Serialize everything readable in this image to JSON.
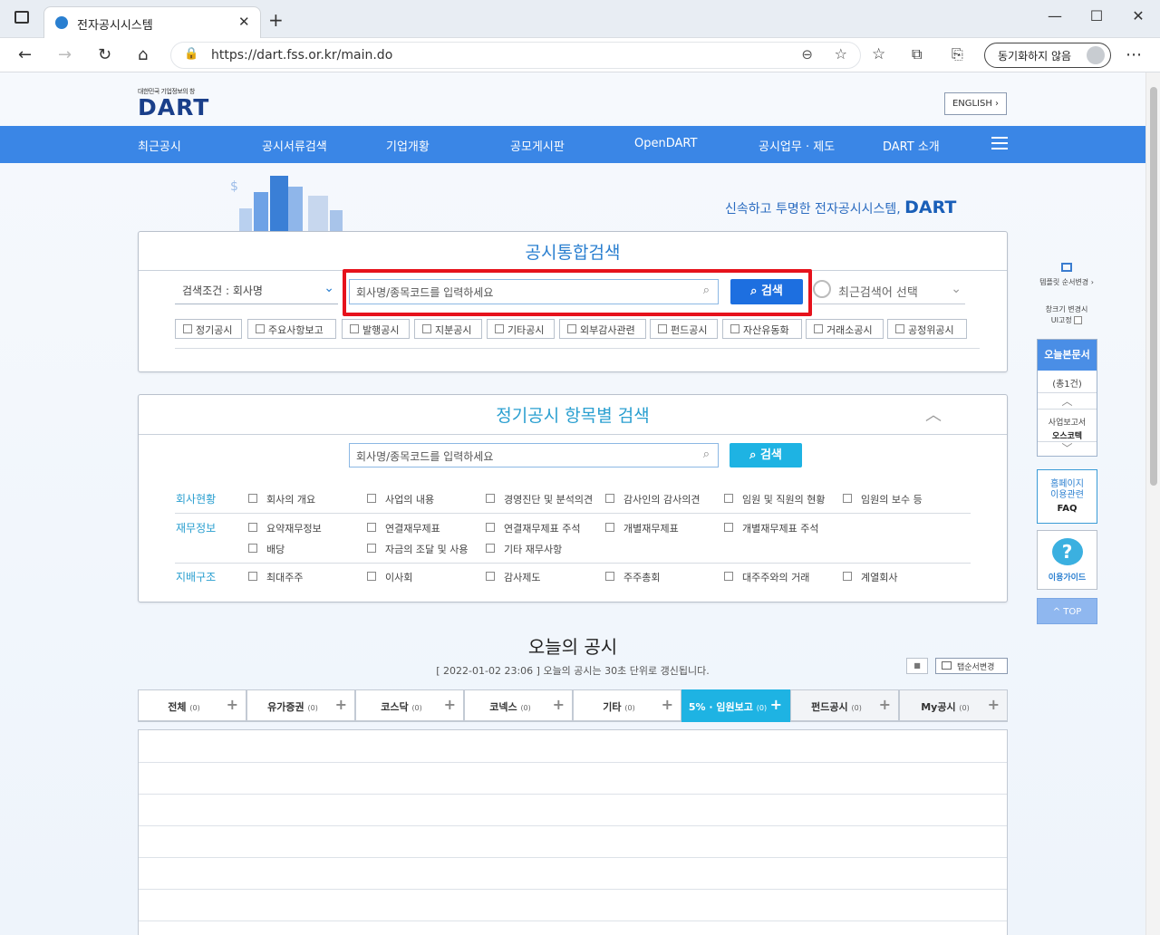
{
  "browser": {
    "tab_title": "전자공시시스템",
    "tab_close": "✕",
    "new_tab": "+",
    "url": "https://dart.fss.or.kr/main.do",
    "sync_label": "동기화하지 않음",
    "win_min": "—",
    "win_max": "☐",
    "win_close": "✕"
  },
  "header": {
    "logo_sub": "대한민국 기업정보의 창",
    "logo_main": "DART",
    "english_label": "ENGLISH ›",
    "slogan": "신속하고 투명한 전자공시시스템,",
    "slogan_brand": "DART"
  },
  "gnb": {
    "items": [
      "최근공시",
      "공시서류검색",
      "기업개황",
      "공모게시판",
      "OpenDART",
      "공시업무 · 제도",
      "DART 소개"
    ]
  },
  "integrated_search": {
    "title": "공시통합검색",
    "condition_label": "검색조건 : 회사명",
    "placeholder": "회사명/종목코드를 입력하세요",
    "search_button": "검색",
    "recent_label": "최근검색어 선택",
    "checkboxes": [
      "정기공시",
      "주요사항보고",
      "발행공시",
      "지분공시",
      "기타공시",
      "외부감사관련",
      "펀드공시",
      "자산유동화",
      "거래소공시",
      "공정위공시"
    ]
  },
  "periodic_search": {
    "title": "정기공시 항목별 검색",
    "placeholder": "회사명/종목코드를 입력하세요",
    "search_button": "검색",
    "categories": [
      {
        "name": "회사현황",
        "items": [
          "회사의 개요",
          "사업의 내용",
          "경영진단 및 분석의견",
          "감사인의 감사의견",
          "임원 및 직원의 현황",
          "임원의 보수 등"
        ]
      },
      {
        "name": "재무정보",
        "items": [
          "요약재무정보",
          "연결재무제표",
          "연결재무제표 주석",
          "개별재무제표",
          "개별재무제표 주석",
          "배당",
          "자금의 조달 및 사용",
          "기타 재무사항"
        ]
      },
      {
        "name": "지배구조",
        "items": [
          "최대주주",
          "이사회",
          "감사제도",
          "주주총회",
          "대주주와의 거래",
          "계열회사"
        ]
      }
    ]
  },
  "today": {
    "title": "오늘의 공시",
    "subtitle": "[ 2022-01-02 23:06 ] 오늘의 공시는 30초 단위로 갱신됩니다.",
    "btn_small": "■",
    "btn_order": "탭순서변경",
    "tabs": [
      {
        "label": "전체",
        "count": "(0)"
      },
      {
        "label": "유가증권",
        "count": "(0)"
      },
      {
        "label": "코스닥",
        "count": "(0)"
      },
      {
        "label": "코넥스",
        "count": "(0)"
      },
      {
        "label": "기타",
        "count": "(0)"
      },
      {
        "label": "5% · 임원보고",
        "count": "(0)"
      },
      {
        "label": "펀드공시",
        "count": "(0)"
      },
      {
        "label": "My공시",
        "count": "(0)"
      }
    ]
  },
  "quick": {
    "template_label": "템플릿 순서변경 ›",
    "window_line1": "창크기 변경시",
    "window_line2": "UI고정",
    "today_docs": "오늘본문서",
    "count": "(총1건)",
    "doc_type": "사업보고서",
    "doc_company": "오스코텍",
    "homepage_line1": "홈페이지",
    "homepage_line2": "이용관련",
    "faq": "FAQ",
    "guide": "이용가이드",
    "top": "^ TOP"
  }
}
